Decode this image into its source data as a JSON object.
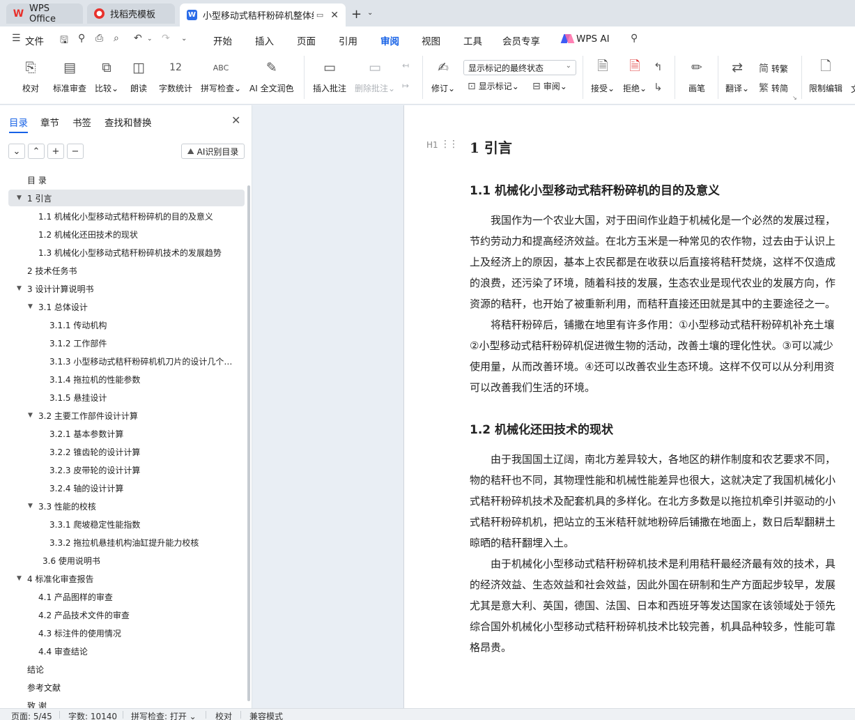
{
  "tabs": {
    "wps": "WPS Office",
    "daoke": "找稻壳模板",
    "doc": "小型移动式秸秆粉碎机整体结"
  },
  "menu": {
    "file": "文件",
    "items": [
      "开始",
      "插入",
      "页面",
      "引用",
      "审阅",
      "视图",
      "工具",
      "会员专享"
    ],
    "active": "审阅",
    "wps_ai": "WPS AI"
  },
  "ribbon": {
    "proofread": "校对",
    "std_review": "标准审查",
    "compare": "比较",
    "read_aloud": "朗读",
    "word_count": "字数统计",
    "spell_check": "拼写检查",
    "ai_polish": "AI 全文润色",
    "insert_comment": "插入批注",
    "delete_comment": "删除批注",
    "revise": "修订",
    "markup_mode": "显示标记的最终状态",
    "show_markup": "显示标记",
    "review": "审阅",
    "accept": "接受",
    "reject": "拒绝",
    "pen": "画笔",
    "translate": "翻译",
    "to_traditional": "转繁",
    "to_simplified": "转简",
    "restrict_edit": "限制编辑",
    "cut_label": "文"
  },
  "nav": {
    "tabs": [
      "目录",
      "章节",
      "书签",
      "查找和替换"
    ],
    "active": "目录",
    "ai_toc": "AI识别目录",
    "toc": [
      {
        "level": 0,
        "text": "目  录",
        "arrow": ""
      },
      {
        "level": 0,
        "text": "1  引言",
        "arrow": "down",
        "selected": true
      },
      {
        "level": 1,
        "text": "1.1  机械化小型移动式秸秆粉碎机的目的及意义",
        "arrow": ""
      },
      {
        "level": 1,
        "text": "1.2  机械化还田技术的现状",
        "arrow": ""
      },
      {
        "level": 1,
        "text": "1.3  机械化小型移动式秸秆粉碎机技术的发展趋势",
        "arrow": ""
      },
      {
        "level": 0,
        "text": "2  技术任务书",
        "arrow": ""
      },
      {
        "level": 0,
        "text": "3  设计计算说明书",
        "arrow": "down"
      },
      {
        "level": 1,
        "text": "3.1  总体设计",
        "arrow": "down"
      },
      {
        "level": 2,
        "text": "3.1.1  传动机构",
        "arrow": ""
      },
      {
        "level": 2,
        "text": "3.1.2  工作部件",
        "arrow": ""
      },
      {
        "level": 2,
        "text": "3.1.3  小型移动式秸秆粉碎机机刀片的设计几个主要参数",
        "arrow": ""
      },
      {
        "level": 2,
        "text": "3.1.4  拖拉机的性能参数",
        "arrow": ""
      },
      {
        "level": 2,
        "text": "3.1.5  悬挂设计",
        "arrow": ""
      },
      {
        "level": 1,
        "text": "3.2  主要工作部件设计计算",
        "arrow": "down"
      },
      {
        "level": 2,
        "text": "3.2.1  基本参数计算",
        "arrow": ""
      },
      {
        "level": 2,
        "text": "3.2.2  锥齿轮的设计计算",
        "arrow": ""
      },
      {
        "level": 2,
        "text": "3.2.3  皮带轮的设计计算",
        "arrow": ""
      },
      {
        "level": 2,
        "text": "3.2.4  轴的设计计算",
        "arrow": ""
      },
      {
        "level": 1,
        "text": "3.3  性能的校核",
        "arrow": "down"
      },
      {
        "level": 2,
        "text": "3.3.1  爬坡稳定性能指数",
        "arrow": ""
      },
      {
        "level": 2,
        "text": "3.3.2  拖拉机悬挂机构油缸提升能力校核",
        "arrow": ""
      },
      {
        "level": 1.5,
        "text": "3.6 使用说明书",
        "arrow": ""
      },
      {
        "level": 0,
        "text": "4  标准化审查报告",
        "arrow": "down"
      },
      {
        "level": 1,
        "text": "4.1  产品图样的审查",
        "arrow": ""
      },
      {
        "level": 1,
        "text": "4.2  产品技术文件的审查",
        "arrow": ""
      },
      {
        "level": 1,
        "text": "4.3  标注件的使用情况",
        "arrow": ""
      },
      {
        "level": 1,
        "text": "4.4  审查结论",
        "arrow": ""
      },
      {
        "level": 0,
        "text": "结论",
        "arrow": ""
      },
      {
        "level": 0,
        "text": "参考文献",
        "arrow": ""
      },
      {
        "level": 0,
        "text": "致  谢",
        "arrow": ""
      }
    ]
  },
  "document": {
    "h1": "1   引言",
    "sections": [
      {
        "h2": "1.1 机械化小型移动式秸秆粉碎机的目的及意义",
        "lines": [
          "　　我国作为一个农业大国，对于田间作业趋于机械化是一个必然的发展过程，",
          "节约劳动力和提高经济效益。在北方玉米是一种常见的农作物，过去由于认识上",
          "上及经济上的原因，基本上农民都是在收获以后直接将秸秆焚烧，这样不仅造成",
          "的浪费，还污染了环境，随着科技的发展，生态农业是现代农业的发展方向，作",
          "资源的秸秆，也开始了被重新利用，而秸秆直接还田就是其中的主要途径之一。",
          "　　将秸秆粉碎后，铺撒在地里有许多作用：①小型移动式秸秆粉碎机补充土壤",
          "②小型移动式秸秆粉碎机促进微生物的活动，改善土壤的理化性状。③可以减少",
          "使用量，从而改善环境。④还可以改善农业生态环境。这样不仅可以从分利用资",
          "可以改善我们生活的环境。"
        ]
      },
      {
        "h2": "1.2 机械化还田技术的现状",
        "lines": [
          "　　由于我国国土辽阔，南北方差异较大，各地区的耕作制度和农艺要求不同，",
          "物的秸秆也不同，其物理性能和机械性能差异也很大，这就决定了我国机械化小",
          "式秸秆粉碎机技术及配套机具的多样化。在北方多数是以拖拉机牵引并驱动的小",
          "式秸秆粉碎机机，把站立的玉米秸秆就地粉碎后铺撒在地面上，数日后犁翻耕土",
          "晾晒的秸秆翻埋入土。",
          "　　由于机械化小型移动式秸秆粉碎机技术是利用秸秆最经济最有效的技术，具",
          "的经济效益、生态效益和社会效益，因此外国在研制和生产方面起步较早，发展",
          "尤其是意大利、英国，德国、法国、日本和西班牙等发达国家在该领域处于领先",
          "综合国外机械化小型移动式秸秆粉碎机技术比较完善，机具品种较多，性能可靠",
          "格昂贵。"
        ]
      }
    ]
  },
  "status": {
    "page": "页面: 5/45",
    "words": "字数: 10140",
    "spell": "拼写检查: 打开",
    "proof": "校对",
    "compat": "兼容模式"
  }
}
